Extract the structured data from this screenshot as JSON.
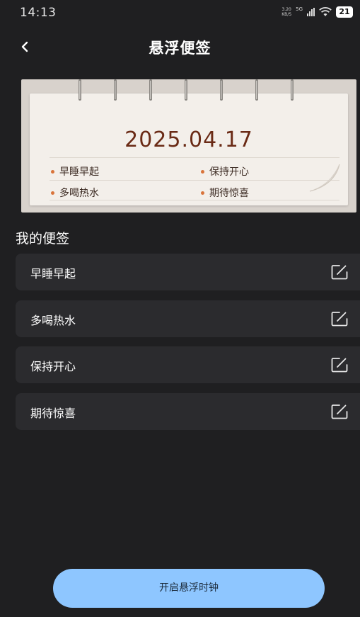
{
  "status_bar": {
    "time": "14:13",
    "net_speed_value": "3.20",
    "net_speed_unit": "KB/S",
    "network_type": "5G",
    "battery": "21"
  },
  "header": {
    "title": "悬浮便签",
    "back_icon": "chevron-left-icon"
  },
  "notepad": {
    "date": "2025.04.17",
    "memos": [
      "早睡早起",
      "保持开心",
      "多喝热水",
      "期待惊喜"
    ]
  },
  "section": {
    "title": "我的便签"
  },
  "notes": [
    {
      "label": "早睡早起",
      "icon": "edit-icon"
    },
    {
      "label": "多喝热水",
      "icon": "edit-icon"
    },
    {
      "label": "保持开心",
      "icon": "edit-icon"
    },
    {
      "label": "期待惊喜",
      "icon": "edit-icon"
    }
  ],
  "footer": {
    "button_label": "开启悬浮时钟"
  },
  "colors": {
    "background": "#1f1f21",
    "card": "#2b2b2e",
    "accent_button": "#8ec6ff",
    "date_text": "#6a2a15",
    "memo_dot": "#d9743b"
  }
}
